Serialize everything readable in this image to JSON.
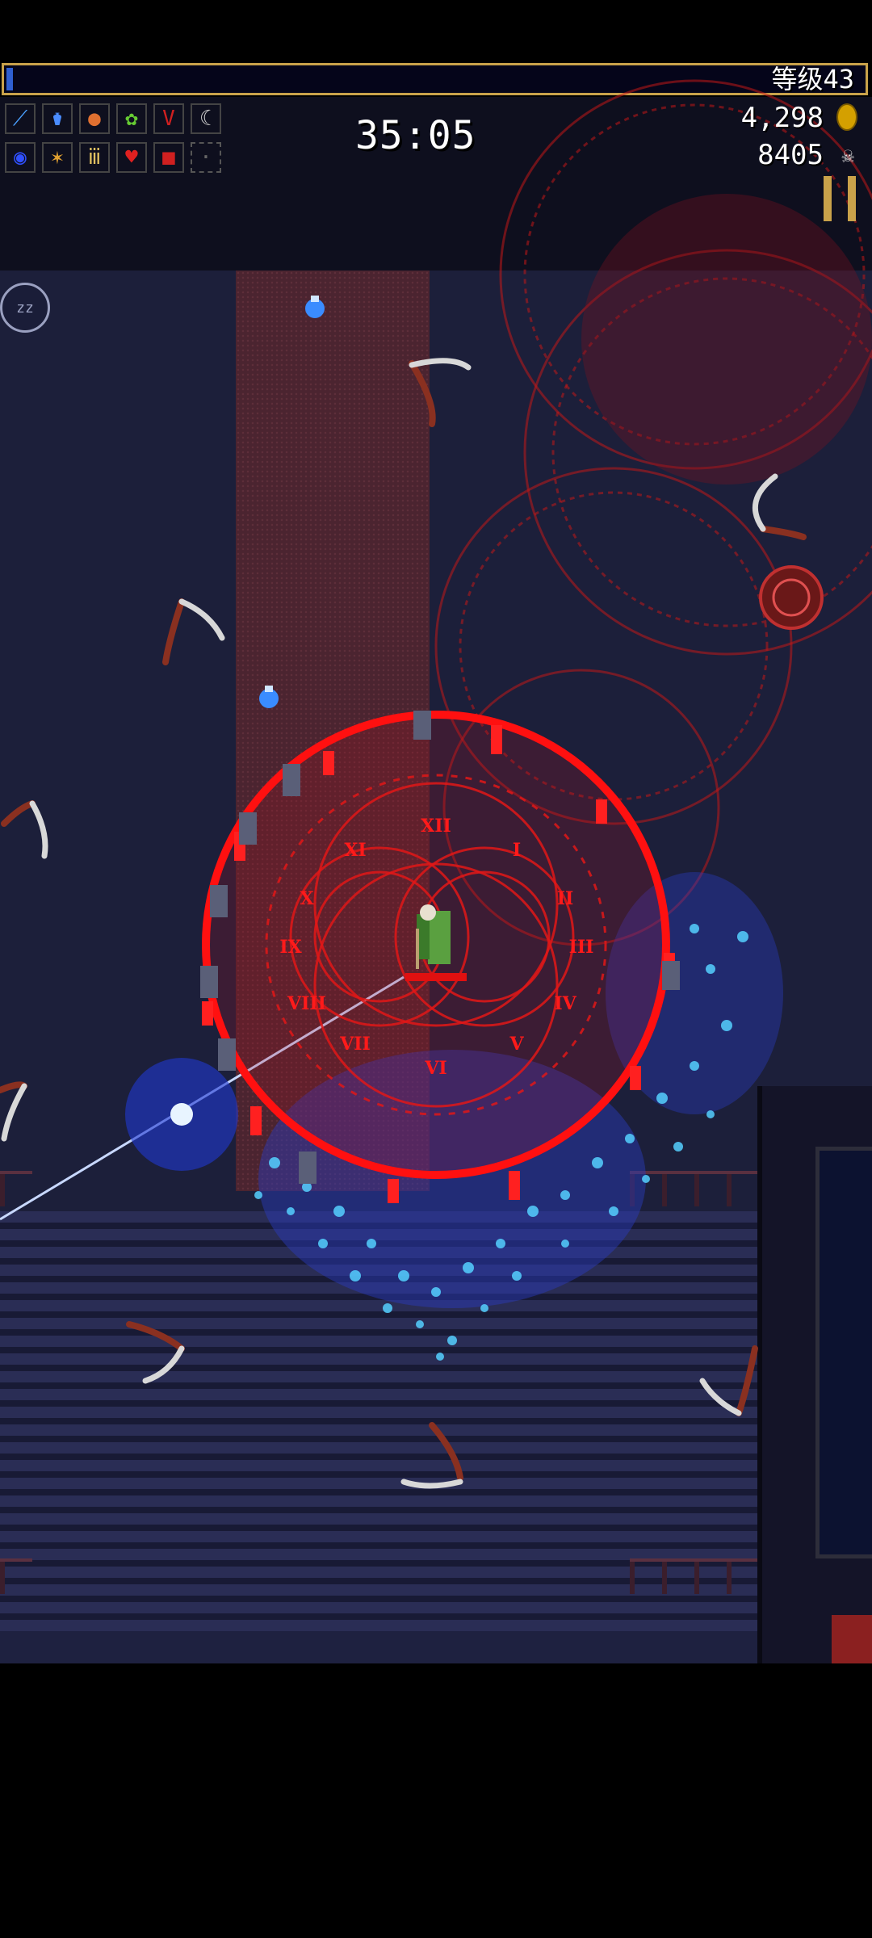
{
  "hud": {
    "level_label": "等级43",
    "xp_progress": 0.006,
    "timer": "35:05",
    "gold": "4,298",
    "kills": "8405",
    "zz_label": "zz"
  },
  "weapon_slots_row1": [
    {
      "icon": "magic-wand-icon",
      "glyph": "⟋",
      "color": "#4aa0ff"
    },
    {
      "icon": "santa-water-icon",
      "glyph": "⚱",
      "color": "#4a8cff"
    },
    {
      "icon": "fire-wand-icon",
      "glyph": "●",
      "color": "#e07030"
    },
    {
      "icon": "garlic-icon",
      "glyph": "✿",
      "color": "#66cc33"
    },
    {
      "icon": "spellbinder-icon",
      "glyph": "V",
      "color": "#d02020"
    },
    {
      "icon": "death-spiral-icon",
      "glyph": "☾",
      "color": "#cccccc"
    }
  ],
  "weapon_slots_row2": [
    {
      "icon": "orb-icon",
      "glyph": "◉",
      "color": "#3050ff"
    },
    {
      "icon": "pummarola-icon",
      "glyph": "✶",
      "color": "#e0a030"
    },
    {
      "icon": "candelabrador-icon",
      "glyph": "ⅲ",
      "color": "#e0c060"
    },
    {
      "icon": "hollow-heart-icon",
      "glyph": "♥",
      "color": "#e02020"
    },
    {
      "icon": "armor-icon",
      "glyph": "■",
      "color": "#d02020"
    },
    {
      "icon": "empty-slot-icon",
      "glyph": "·",
      "color": "#666666"
    }
  ],
  "colors": {
    "xp_fill": "#2f5fd0",
    "xp_border": "#c9a24a",
    "clock_red": "#ff1010",
    "water_blue": "#40c8ff"
  }
}
